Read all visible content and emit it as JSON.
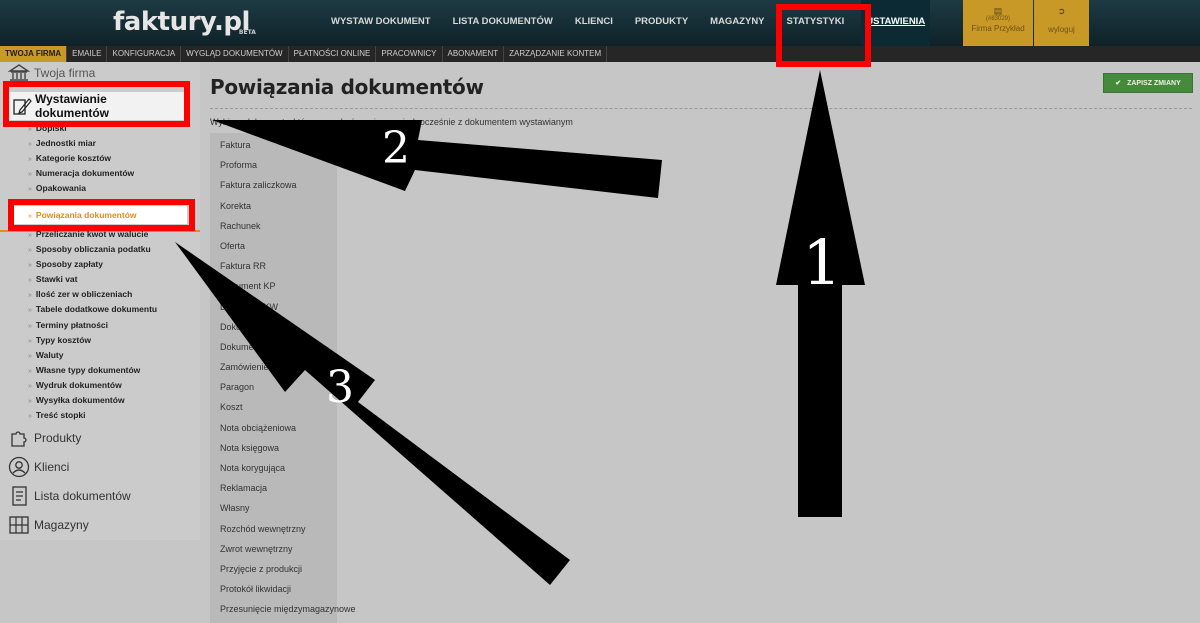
{
  "header": {
    "logo": "faktury.pl",
    "logo_badge": "BETA",
    "nav": [
      "WYSTAW DOKUMENT",
      "LISTA DOKUMENTÓW",
      "KLIENCI",
      "PRODUKTY",
      "MAGAZYNY",
      "STATYSTYKI",
      "USTAWIENIA"
    ],
    "firm_id": "(#83029)",
    "firm_name": "Firma Przykład",
    "logout_label": "wyloguj"
  },
  "subnav": [
    "TWOJA FIRMA",
    "EMAILE",
    "KONFIGURACJA",
    "WYGLĄD DOKUMENTÓW",
    "PŁATNOŚCI ONLINE",
    "PRACOWNICY",
    "ABONAMENT",
    "ZARZĄDZANIE KONTEM"
  ],
  "sidebar": {
    "top_category": "Twoja firma",
    "active_category": "Wystawianie dokumentów",
    "items_before": [
      "Dopiski",
      "Jednostki miar",
      "Kategorie kosztów",
      "Numeracja dokumentów",
      "Opakowania"
    ],
    "selected_item": "Powiązania dokumentów",
    "items_after": [
      "Przeliczanie kwot w walucie",
      "Sposoby obliczania podatku",
      "Sposoby zapłaty",
      "Stawki vat",
      "Ilość zer w obliczeniach",
      "Tabele dodatkowe dokumentu",
      "Terminy płatności",
      "Typy kosztów",
      "Waluty",
      "Własne typy dokumentów",
      "Wydruk dokumentów",
      "Wysyłka dokumentów",
      "Treść stopki"
    ],
    "categories": [
      "Produkty",
      "Klienci",
      "Lista dokumentów",
      "Magazyny"
    ]
  },
  "main": {
    "title": "Powiązania dokumentów",
    "save_label": "ZAPISZ ZMIANY",
    "description": "Wybierz dokumenty, które mogą być powiązane jednocześnie z dokumentem wystawianym",
    "documents": [
      "Faktura",
      "Proforma",
      "Faktura zaliczkowa",
      "Korekta",
      "Rachunek",
      "Oferta",
      "Faktura RR",
      "Dokument KP",
      "Dokument KW",
      "Dokument PZ",
      "Dokument PZ",
      "Zamówienie",
      "Paragon",
      "Koszt",
      "Nota obciążeniowa",
      "Nota księgowa",
      "Nota korygująca",
      "Reklamacja",
      "Własny",
      "Rozchód wewnętrzny",
      "Zwrot wewnętrzny",
      "Przyjęcie z produkcji",
      "Protokół likwidacji",
      "Przesunięcie międzymagazynowe"
    ]
  },
  "annotations": {
    "labels": [
      "1",
      "2",
      "3"
    ],
    "color": "#ff0000"
  },
  "colors": {
    "accent": "#c99928",
    "active_text": "#e38b1e",
    "save_button": "#468a3b"
  }
}
